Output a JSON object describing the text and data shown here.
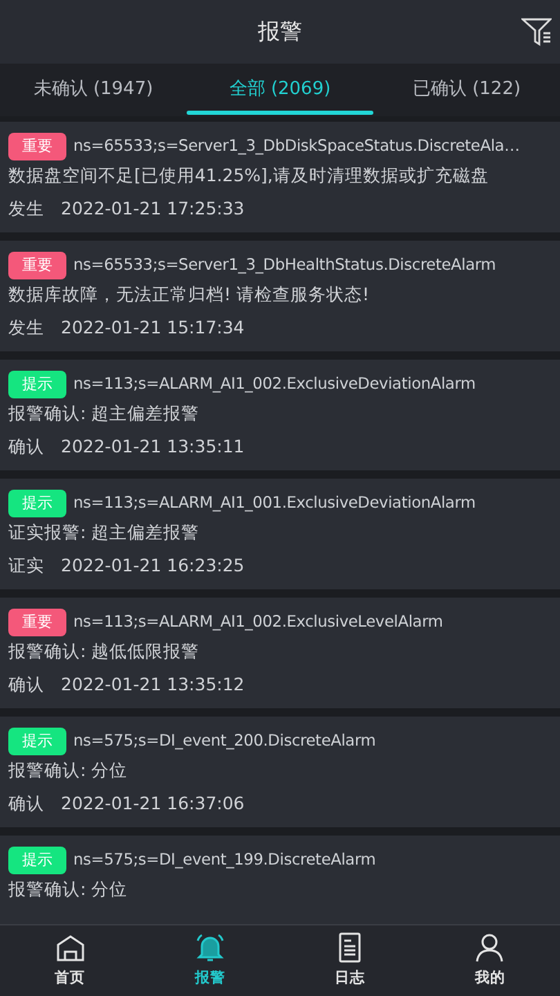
{
  "header": {
    "title": "报警"
  },
  "tabs": [
    {
      "label": "未确认 (1947)",
      "selected": false
    },
    {
      "label": "全部 (2069)",
      "selected": true
    },
    {
      "label": "已确认 (122)",
      "selected": false
    }
  ],
  "alarms": [
    {
      "tag": "重要",
      "color": "#f4587a",
      "source": "ns=65533;s=Server1_3_DbDiskSpaceStatus.DiscreteAla…",
      "message": "数据盘空间不足[已使用41.25%],请及时清理数据或扩充磁盘",
      "status": "发生",
      "time": "2022-01-21 17:25:33"
    },
    {
      "tag": "重要",
      "color": "#f4587a",
      "source": "ns=65533;s=Server1_3_DbHealthStatus.DiscreteAlarm",
      "message": "数据库故障，无法正常归档! 请检查服务状态!",
      "status": "发生",
      "time": "2022-01-21 15:17:34"
    },
    {
      "tag": "提示",
      "color": "#15e580",
      "source": "ns=113;s=ALARM_AI1_002.ExclusiveDeviationAlarm",
      "message": "报警确认: 超主偏差报警",
      "status": "确认",
      "time": "2022-01-21 13:35:11"
    },
    {
      "tag": "提示",
      "color": "#15e580",
      "source": "ns=113;s=ALARM_AI1_001.ExclusiveDeviationAlarm",
      "message": "证实报警: 超主偏差报警",
      "status": "证实",
      "time": "2022-01-21 16:23:25"
    },
    {
      "tag": "重要",
      "color": "#f4587a",
      "source": "ns=113;s=ALARM_AI1_002.ExclusiveLevelAlarm",
      "message": "报警确认: 越低低限报警",
      "status": "确认",
      "time": "2022-01-21 13:35:12"
    },
    {
      "tag": "提示",
      "color": "#15e580",
      "source": "ns=575;s=DI_event_200.DiscreteAlarm",
      "message": "报警确认: 分位",
      "status": "确认",
      "time": "2022-01-21 16:37:06"
    },
    {
      "tag": "提示",
      "color": "#15e580",
      "source": "ns=575;s=DI_event_199.DiscreteAlarm",
      "message": "报警确认: 分位"
    }
  ],
  "bottom_nav": [
    {
      "label": "首页",
      "kind": "home",
      "selected": false
    },
    {
      "label": "报警",
      "kind": "bell",
      "selected": true
    },
    {
      "label": "日志",
      "kind": "log",
      "selected": false
    },
    {
      "label": "我的",
      "kind": "user",
      "selected": false
    }
  ]
}
